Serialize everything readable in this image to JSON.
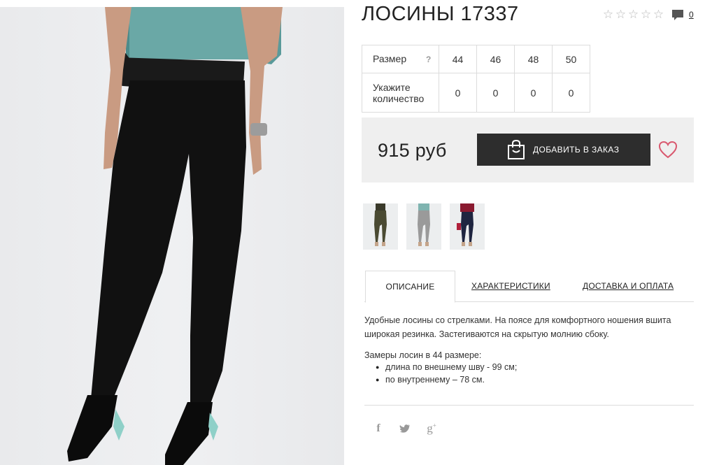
{
  "product": {
    "title": "ЛОСИНЫ 17337",
    "rating": {
      "stars_filled": 0,
      "stars_total": 5
    },
    "comment_count": "0"
  },
  "sizes": {
    "row_label": "Размер",
    "help": "?",
    "values": [
      "44",
      "46",
      "48",
      "50"
    ],
    "qty_label": "Укажите количество",
    "quantities": [
      "0",
      "0",
      "0",
      "0"
    ]
  },
  "purchase": {
    "price": "915 руб",
    "add_button": "ДОБАВИТЬ В ЗАКАЗ"
  },
  "tabs": [
    {
      "label": "ОПИСАНИЕ",
      "active": true
    },
    {
      "label": "ХАРАКТЕРИСТИКИ",
      "active": false
    },
    {
      "label": "ДОСТАВКА И ОПЛАТА",
      "active": false
    }
  ],
  "description": {
    "paragraph": "Удобные лосины со стрелками. На поясе для комфортного ношения вшита широкая резинка. Застегиваются на скрытую молнию сбоку.",
    "measure_title": "Замеры лосин в 44 размере:",
    "measures": [
      "длина по внешнему шву - 99 см;",
      "по внутреннему – 78 см."
    ]
  },
  "thumbnails": [
    {
      "color": "olive",
      "hex": "#4a4a32"
    },
    {
      "color": "grey",
      "hex": "#9a9a9a"
    },
    {
      "color": "navy",
      "hex": "#1f2540"
    }
  ],
  "social": [
    "facebook-icon",
    "twitter-icon",
    "google-plus-icon"
  ],
  "colors": {
    "button": "#2d2d2d",
    "heart": "#d9586e",
    "price_bg": "#efefef"
  }
}
